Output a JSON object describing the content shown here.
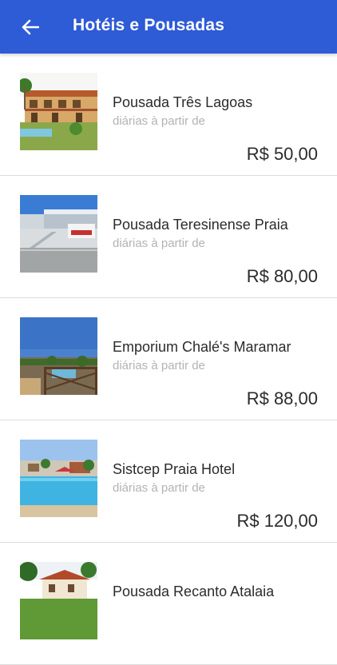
{
  "header": {
    "title": "Hotéis e Pousadas",
    "back_icon": "arrow-left-icon",
    "background": "#2e5bd6"
  },
  "hotels": [
    {
      "name": "Pousada Três Lagoas",
      "subtitle": "diárias à partir de",
      "price": "R$ 50,00"
    },
    {
      "name": "Pousada Teresinense Praia",
      "subtitle": "diárias à partir de",
      "price": "R$ 80,00"
    },
    {
      "name": "Emporium Chalé's Maramar",
      "subtitle": "diárias à partir de",
      "price": "R$ 88,00"
    },
    {
      "name": "Sistcep Praia Hotel",
      "subtitle": "diárias à partir de",
      "price": "R$ 120,00"
    },
    {
      "name": "Pousada Recanto Atalaia",
      "subtitle": "",
      "price": ""
    }
  ]
}
